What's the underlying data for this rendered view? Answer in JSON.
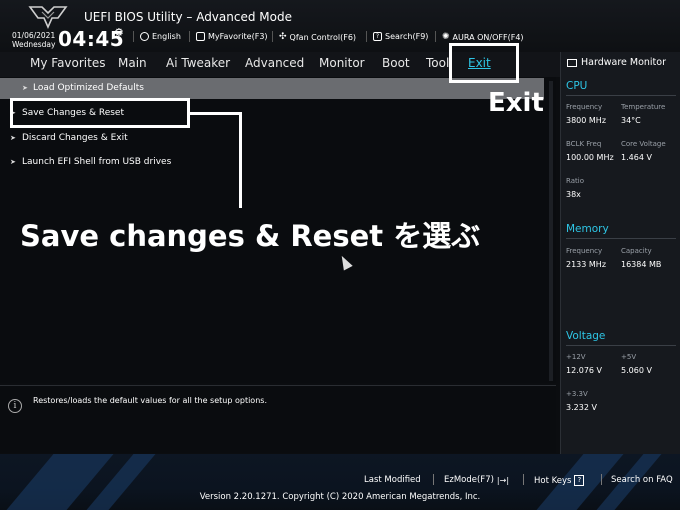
{
  "header": {
    "title": "UEFI BIOS Utility – Advanced Mode",
    "date": "01/06/2021",
    "weekday": "Wednesday",
    "time": "04:45",
    "toolbar": [
      {
        "label": "English",
        "icon": "globe-icon"
      },
      {
        "label": "MyFavorite(F3)",
        "icon": "favorite-icon"
      },
      {
        "label": "Qfan Control(F6)",
        "icon": "fan-icon"
      },
      {
        "label": "Search(F9)",
        "icon": "search-icon"
      },
      {
        "label": "AURA ON/OFF(F4)",
        "icon": "aura-icon"
      }
    ]
  },
  "nav": {
    "tabs": [
      "My Favorites",
      "Main",
      "Ai Tweaker",
      "Advanced",
      "Monitor",
      "Boot",
      "Tool",
      "Exit"
    ],
    "active": "Exit"
  },
  "menu": {
    "items": [
      "Load Optimized Defaults",
      "Save Changes & Reset",
      "Discard Changes & Exit",
      "Launch EFI Shell from USB drives"
    ]
  },
  "annotations": {
    "exit_label": "Exit",
    "instruction": "Save changes & Reset を選ぶ"
  },
  "info": {
    "text": "Restores/loads the default values for all the setup options."
  },
  "hardware_monitor": {
    "title": "Hardware Monitor",
    "cpu": {
      "heading": "CPU",
      "frequency_label": "Frequency",
      "frequency": "3800 MHz",
      "temperature_label": "Temperature",
      "temperature": "34°C",
      "bclk_label": "BCLK Freq",
      "bclk": "100.00 MHz",
      "core_voltage_label": "Core Voltage",
      "core_voltage": "1.464 V",
      "ratio_label": "Ratio",
      "ratio": "38x"
    },
    "memory": {
      "heading": "Memory",
      "frequency_label": "Frequency",
      "frequency": "2133 MHz",
      "capacity_label": "Capacity",
      "capacity": "16384 MB"
    },
    "voltage": {
      "heading": "Voltage",
      "v12_label": "+12V",
      "v12": "12.076 V",
      "v5_label": "+5V",
      "v5": "5.060 V",
      "v33_label": "+3.3V",
      "v33": "3.232 V"
    }
  },
  "footer": {
    "last_modified": "Last Modified",
    "ezmode": "EzMode(F7)",
    "hotkeys": "Hot Keys",
    "hotkeys_key": "?",
    "faq": "Search on FAQ",
    "version": "Version 2.20.1271. Copyright (C) 2020 American Megatrends, Inc."
  }
}
